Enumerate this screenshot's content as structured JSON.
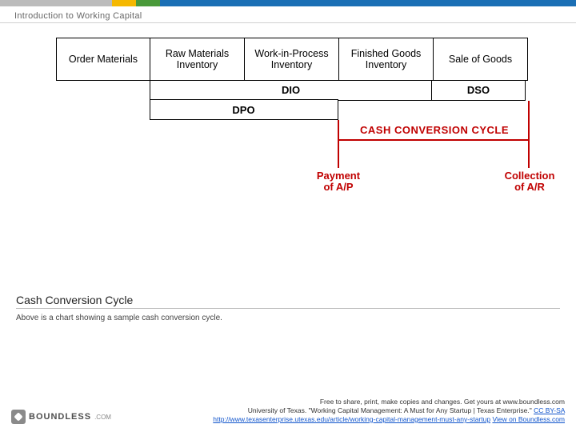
{
  "header": {
    "title": "Introduction to Working Capital"
  },
  "diagram": {
    "stages": [
      "Order Materials",
      "Raw Materials Inventory",
      "Work-in-Process Inventory",
      "Finished Goods Inventory",
      "Sale of Goods"
    ],
    "metrics": {
      "dio": "DIO",
      "dso": "DSO",
      "dpo": "DPO"
    },
    "labels": {
      "payment": "Payment of A/P",
      "collection": "Collection of A/R",
      "ccc": "CASH CONVERSION CYCLE"
    }
  },
  "caption": {
    "title": "Cash Conversion Cycle",
    "desc": "Above is a chart showing a sample cash conversion cycle."
  },
  "footer": {
    "logo_name": "BOUNDLESS",
    "logo_tld": ".COM",
    "line1_prefix": "Free to share, print, make copies and changes. Get yours at ",
    "line1_link": "www.boundless.com",
    "line2_src": "University of Texas. \"Working Capital Management: A Must for Any Startup | Texas Enterprise.\" ",
    "line2_license": "CC BY-SA",
    "line2_url_text": "http://www.texasenterprise.utexas.edu/article/working-capital-management-must-any-startup",
    "line2_view": "View on Boundless.com"
  }
}
